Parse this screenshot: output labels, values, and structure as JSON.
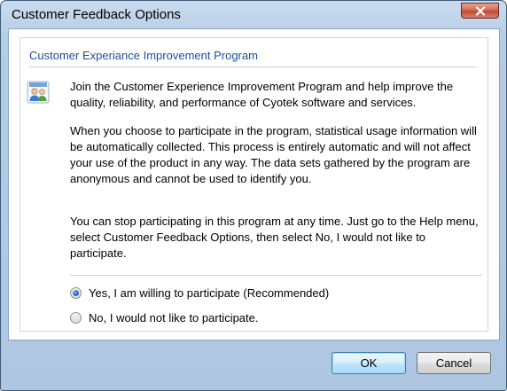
{
  "window": {
    "title": "Customer Feedback Options"
  },
  "section": {
    "title": "Customer Experiance Improvement Program"
  },
  "paragraphs": [
    "Join the Customer Experience Improvement Program and help improve the quality, reliability, and performance of Cyotek software and services.",
    "When you choose to participate in the program, statistical usage information will be automatically collected. This process is entirely automatic and will not affect your use of the product in any way. The data sets gathered by the program are anonymous and cannot be used to identify you.",
    "You can stop participating in this program at any time. Just go to the Help menu, select Customer Feedback Options, then select No, I would not like to participate."
  ],
  "options": {
    "yes_label": "Yes, I am willing to participate (Recommended)",
    "no_label": "No, I would not like to participate.",
    "selected": "yes"
  },
  "buttons": {
    "ok_label": "OK",
    "cancel_label": "Cancel"
  },
  "icons": {
    "title_close": "close-icon",
    "program": "people-icon"
  },
  "colors": {
    "section_title": "#1e4e9a",
    "window_frame": "#aec6e1"
  }
}
